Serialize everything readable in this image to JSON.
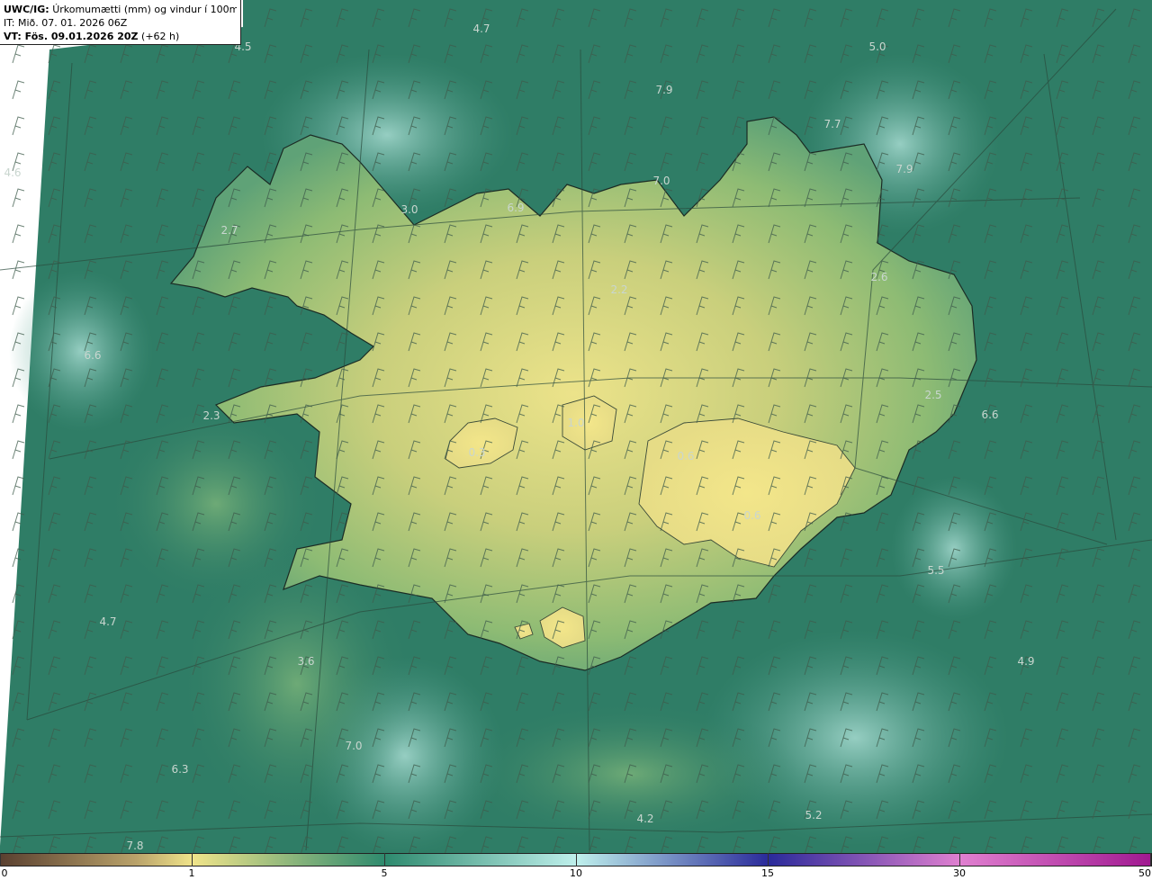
{
  "header": {
    "model_label": "UWC/IG:",
    "title": "Úrkomumætti (mm) og vindur í 100m hæð",
    "init_time": "IT: Mið. 07. 01. 2026 06Z",
    "valid_label": "VT: Fös. 09.01.2026 20Z",
    "valid_offset": "(+62 h)"
  },
  "colorbar": {
    "ticks": [
      {
        "label": "0",
        "value": 0
      },
      {
        "label": "1",
        "value": 1
      },
      {
        "label": "5",
        "value": 5
      },
      {
        "label": "10",
        "value": 10
      },
      {
        "label": "15",
        "value": 15
      },
      {
        "label": "30",
        "value": 30
      },
      {
        "label": "50",
        "value": 50
      }
    ],
    "colors": [
      "#5a4030",
      "#b9a26a",
      "#f0e48a",
      "#2e8a6e",
      "#bff0ec",
      "#2a2a9a",
      "#e080d0",
      "#a01890"
    ]
  },
  "map_values": [
    {
      "label": "4.7",
      "pos": [
        535,
        32
      ]
    },
    {
      "label": "4.5",
      "pos": [
        270,
        52
      ]
    },
    {
      "label": "5.0",
      "pos": [
        975,
        52
      ]
    },
    {
      "label": "7.9",
      "pos": [
        738,
        100
      ]
    },
    {
      "label": "7.7",
      "pos": [
        925,
        138
      ]
    },
    {
      "label": "7.9",
      "pos": [
        1005,
        188
      ]
    },
    {
      "label": "4.6",
      "pos": [
        14,
        192
      ]
    },
    {
      "label": "7.0",
      "pos": [
        735,
        201
      ]
    },
    {
      "label": "6.9",
      "pos": [
        573,
        231
      ]
    },
    {
      "label": "3.0",
      "pos": [
        455,
        233
      ]
    },
    {
      "label": "2.7",
      "pos": [
        255,
        256
      ]
    },
    {
      "label": "2.6",
      "pos": [
        977,
        308
      ]
    },
    {
      "label": "2.2",
      "pos": [
        688,
        322
      ]
    },
    {
      "label": "6.6",
      "pos": [
        103,
        395
      ]
    },
    {
      "label": "2.5",
      "pos": [
        1037,
        439
      ]
    },
    {
      "label": "2.3",
      "pos": [
        235,
        462
      ]
    },
    {
      "label": "6.6",
      "pos": [
        1100,
        461
      ]
    },
    {
      "label": "1.0",
      "pos": [
        640,
        470
      ]
    },
    {
      "label": "0.3",
      "pos": [
        530,
        503
      ]
    },
    {
      "label": "0.6",
      "pos": [
        762,
        507
      ]
    },
    {
      "label": "0.6",
      "pos": [
        836,
        573
      ]
    },
    {
      "label": "5.5",
      "pos": [
        1040,
        634
      ]
    },
    {
      "label": "4.7",
      "pos": [
        120,
        691
      ]
    },
    {
      "label": "3.6",
      "pos": [
        340,
        735
      ]
    },
    {
      "label": "4.9",
      "pos": [
        1140,
        735
      ]
    },
    {
      "label": "7.0",
      "pos": [
        393,
        829
      ]
    },
    {
      "label": "6.3",
      "pos": [
        200,
        855
      ]
    },
    {
      "label": "4.2",
      "pos": [
        717,
        910
      ]
    },
    {
      "label": "5.2",
      "pos": [
        904,
        906
      ]
    },
    {
      "label": "7.8",
      "pos": [
        150,
        940
      ]
    }
  ]
}
